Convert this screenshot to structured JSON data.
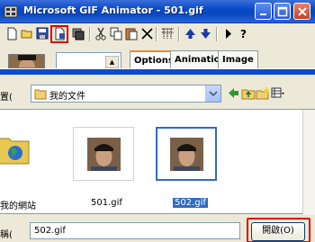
{
  "window": {
    "title": "Microsoft GIF Animator - 501.gif"
  },
  "titlebar_buttons": [
    {
      "name": "minimize",
      "icon": "minimize-icon"
    },
    {
      "name": "maximize",
      "icon": "maximize-icon"
    },
    {
      "name": "close",
      "icon": "close-icon"
    }
  ],
  "toolbar": {
    "tools": [
      "new-icon",
      "open-icon",
      "save-icon",
      "insert-icon",
      "save-as-icon",
      "cut-icon",
      "copy-icon",
      "paste-icon",
      "delete-icon",
      "select-all-icon",
      "move-up-icon",
      "move-down-icon",
      "play-icon",
      "help-icon"
    ]
  },
  "tabs": [
    {
      "label": "Options",
      "active": true
    },
    {
      "label": "Animation",
      "active": false
    },
    {
      "label": "Image",
      "active": false
    }
  ],
  "dialog": {
    "look_in_label": "置(",
    "look_in_value": "我的文件",
    "files": [
      {
        "label": "我的網站",
        "type": "folder"
      },
      {
        "label": "501.gif",
        "type": "gif",
        "selected": false
      },
      {
        "label": "502.gif",
        "type": "gif",
        "selected": true
      }
    ],
    "filename_label": "稱(",
    "filename_value": "502.gif",
    "open_button": "開啟(O)"
  },
  "colors": {
    "highlight": "#e00000",
    "selection": "#316ac5",
    "titlebar": "#0a49c8"
  }
}
